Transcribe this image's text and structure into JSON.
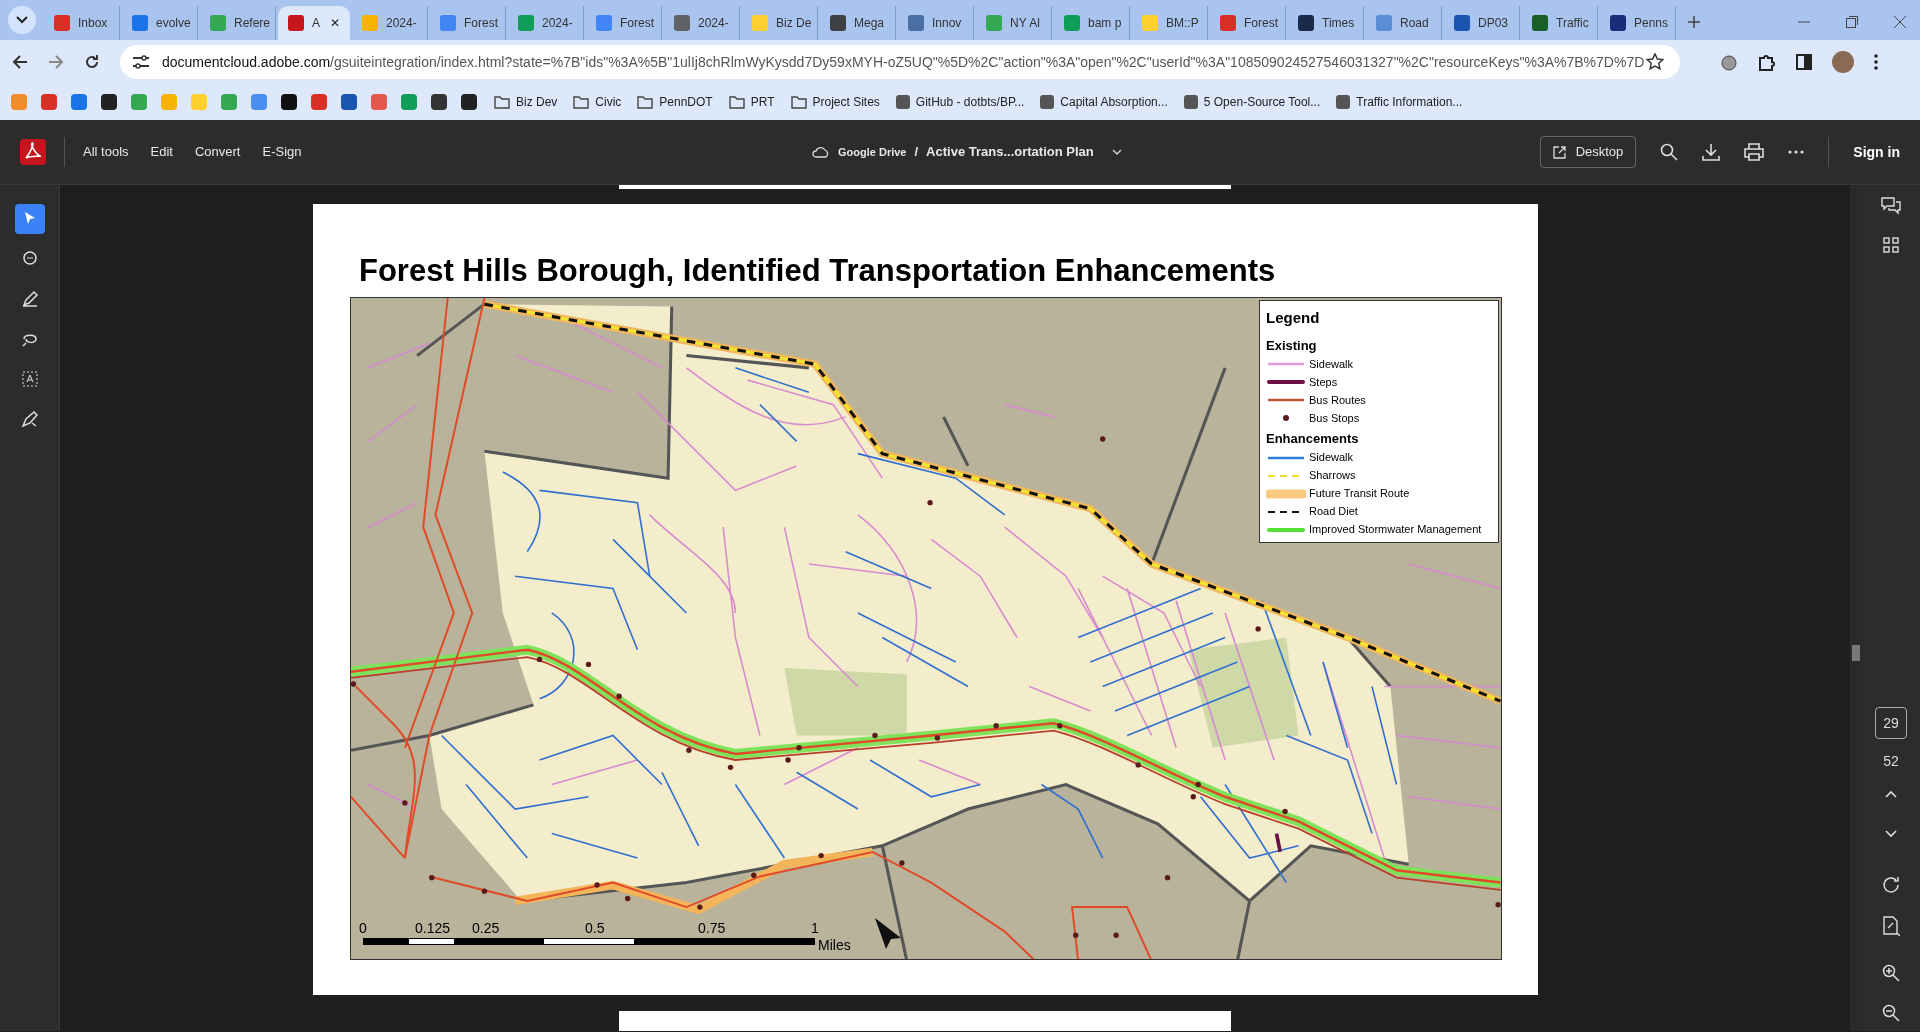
{
  "browser": {
    "tabs": [
      {
        "label": "Inbox",
        "selected": false
      },
      {
        "label": "evolve",
        "selected": false
      },
      {
        "label": "Refere",
        "selected": false
      },
      {
        "label": "A",
        "selected": true,
        "close": "✕"
      },
      {
        "label": "2024-",
        "selected": false
      },
      {
        "label": "Forest",
        "selected": false
      },
      {
        "label": "2024-",
        "selected": false
      },
      {
        "label": "Forest",
        "selected": false
      },
      {
        "label": "2024-",
        "selected": false
      },
      {
        "label": "Biz De",
        "selected": false
      },
      {
        "label": "Mega",
        "selected": false
      },
      {
        "label": "Innov",
        "selected": false
      },
      {
        "label": "NY Al",
        "selected": false
      },
      {
        "label": "bam p",
        "selected": false
      },
      {
        "label": "BM::P",
        "selected": false
      },
      {
        "label": "Forest",
        "selected": false
      },
      {
        "label": "Times",
        "selected": false
      },
      {
        "label": "Road",
        "selected": false
      },
      {
        "label": "DP03",
        "selected": false
      },
      {
        "label": "Traffic",
        "selected": false
      },
      {
        "label": "Penns",
        "selected": false
      }
    ],
    "url_domain": "documentcloud.adobe.com",
    "url_path": "/gsuiteintegration/index.html?state=%7B\"ids\"%3A%5B\"1ulIj8chRlmWyKysdd7Dy59xMYH-oZ5UQ\"%5D%2C\"action\"%3A\"open\"%2C\"userId\"%3A\"108509024527546031327\"%2C\"resourceKeys\"%3A%7B%7D%7D",
    "bookmarks": [
      {
        "kind": "icon"
      },
      {
        "kind": "icon"
      },
      {
        "kind": "icon"
      },
      {
        "kind": "icon"
      },
      {
        "kind": "icon"
      },
      {
        "kind": "icon"
      },
      {
        "kind": "icon"
      },
      {
        "kind": "icon"
      },
      {
        "kind": "icon"
      },
      {
        "kind": "icon"
      },
      {
        "kind": "icon"
      },
      {
        "kind": "icon"
      },
      {
        "kind": "icon"
      },
      {
        "kind": "icon"
      },
      {
        "kind": "icon"
      },
      {
        "kind": "icon"
      },
      {
        "kind": "folder",
        "label": "Biz Dev"
      },
      {
        "kind": "folder",
        "label": "Civic"
      },
      {
        "kind": "folder",
        "label": "PennDOT"
      },
      {
        "kind": "folder",
        "label": "PRT"
      },
      {
        "kind": "folder",
        "label": "Project Sites"
      },
      {
        "kind": "link",
        "label": "GitHub - dotbts/BP..."
      },
      {
        "kind": "link",
        "label": "Capital Absorption..."
      },
      {
        "kind": "link",
        "label": "5 Open-Source Tool..."
      },
      {
        "kind": "link",
        "label": "Traffic Information..."
      }
    ]
  },
  "toolbar": {
    "menu": [
      "All tools",
      "Edit",
      "Convert",
      "E-Sign"
    ],
    "location": "Google Drive",
    "separator": "/",
    "document": "Active Trans...ortation Plan",
    "desktop_button": "Desktop",
    "sign_in": "Sign in"
  },
  "tools": [
    {
      "selected": true
    },
    {
      "selected": false
    },
    {
      "selected": false
    },
    {
      "selected": false
    },
    {
      "selected": false
    },
    {
      "selected": false
    }
  ],
  "page": {
    "title": "Forest Hills Borough, Identified Transportation Enhancements",
    "legend": {
      "title": "Legend",
      "sections": [
        {
          "heading": "Existing",
          "items": [
            {
              "label": "Sidewalk",
              "kind": "line",
              "color": "#e59ad8"
            },
            {
              "label": "Steps",
              "kind": "thick",
              "color": "#6b0f46"
            },
            {
              "label": "Bus Routes",
              "kind": "line",
              "color": "#c0503a"
            },
            {
              "label": "Bus Stops",
              "kind": "dot",
              "color": "#5a1a1a"
            }
          ]
        },
        {
          "heading": "Enhancements",
          "items": [
            {
              "label": "Sidewalk",
              "kind": "line",
              "color": "#2f7fd8"
            },
            {
              "label": "Sharrows",
              "kind": "dashed",
              "color": "#e8e02a"
            },
            {
              "label": "Future Transit Route",
              "kind": "wide",
              "color": "#f8c97e"
            },
            {
              "label": "Road Diet",
              "kind": "dashed",
              "color": "#111111"
            },
            {
              "label": "Improved Stormwater Management",
              "kind": "thick",
              "color": "#55e034"
            }
          ]
        }
      ]
    },
    "scale": {
      "labels": [
        "0",
        "0.125",
        "0.25",
        "0.5",
        "0.75",
        "1"
      ],
      "unit": "Miles"
    }
  },
  "pager": {
    "current": "29",
    "total": "52"
  }
}
